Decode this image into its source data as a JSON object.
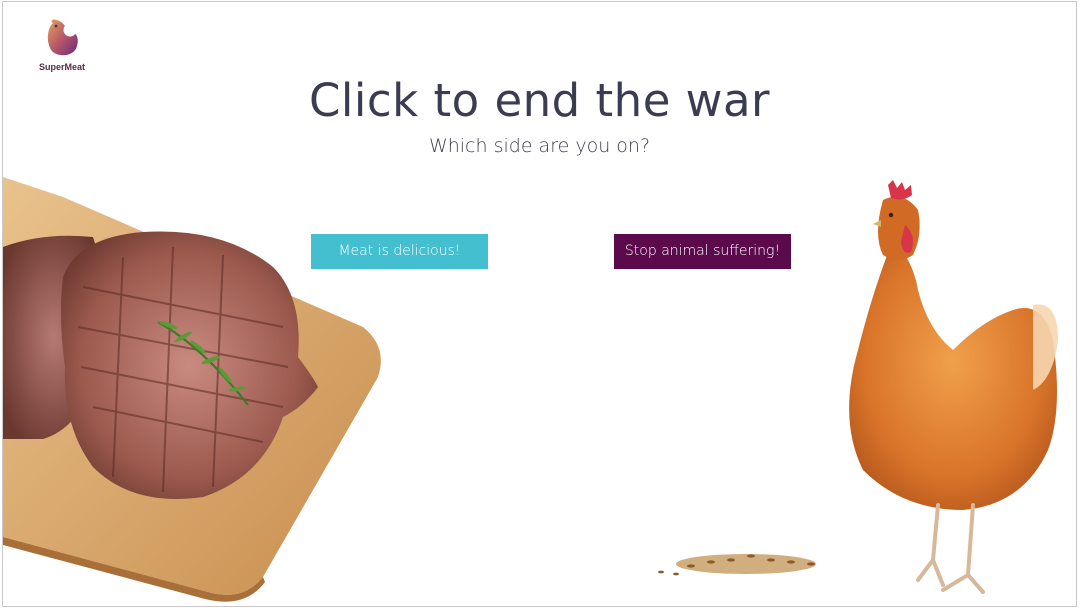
{
  "brand": {
    "name": "SuperMeat"
  },
  "hero": {
    "title": "Click to end the war",
    "subtitle": "Which side are you on?"
  },
  "buttons": {
    "meat_label": "Meat is delicious!",
    "stop_label": "Stop animal suffering!"
  },
  "colors": {
    "meat_button": "#43bfcf",
    "stop_button": "#5b0a4c",
    "title": "#3b3b52"
  },
  "images": [
    "steak-on-cutting-board",
    "hen",
    "grain-seeds"
  ]
}
